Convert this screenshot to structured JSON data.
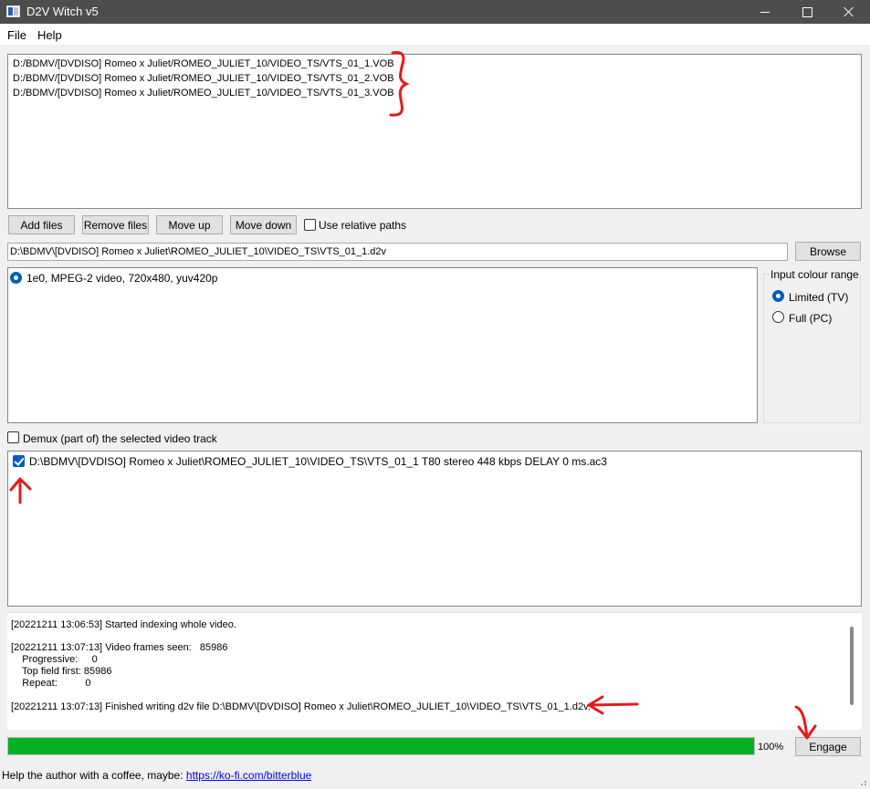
{
  "window": {
    "title": "D2V Witch v5"
  },
  "menu": {
    "file": "File",
    "help": "Help"
  },
  "files": [
    "D:/BDMV/[DVDISO] Romeo x Juliet/ROMEO_JULIET_10/VIDEO_TS/VTS_01_1.VOB",
    "D:/BDMV/[DVDISO] Romeo x Juliet/ROMEO_JULIET_10/VIDEO_TS/VTS_01_2.VOB",
    "D:/BDMV/[DVDISO] Romeo x Juliet/ROMEO_JULIET_10/VIDEO_TS/VTS_01_3.VOB"
  ],
  "file_buttons": {
    "add": "Add files",
    "remove": "Remove files",
    "move_up": "Move up",
    "move_down": "Move down",
    "relative_paths": "Use relative paths"
  },
  "output": {
    "path": "D:\\BDMV\\[DVDISO] Romeo x Juliet\\ROMEO_JULIET_10\\VIDEO_TS\\VTS_01_1.d2v",
    "browse": "Browse"
  },
  "video_tracks": [
    "1e0, MPEG-2 video, 720x480, yuv420p"
  ],
  "colour_range": {
    "title": "Input colour range",
    "limited": "Limited (TV)",
    "full": "Full (PC)",
    "selected": "limited"
  },
  "demux_label": "Demux (part of) the selected video track",
  "audio_tracks": [
    {
      "label": "D:\\BDMV\\[DVDISO] Romeo x Juliet\\ROMEO_JULIET_10\\VIDEO_TS\\VTS_01_1 T80 stereo 448 kbps DELAY 0 ms.ac3",
      "checked": true
    }
  ],
  "log": {
    "l1": "[20221211 13:06:53] Started indexing whole video.",
    "l2": "[20221211 13:07:13] Video frames seen:   85986",
    "l3": "    Progressive:     0",
    "l4": "    Top field first: 85986",
    "l5": "    Repeat:          0",
    "l6": "[20221211 13:07:13] Finished writing d2v file D:\\BDMV\\[DVDISO] Romeo x Juliet\\ROMEO_JULIET_10\\VIDEO_TS\\VTS_01_1.d2v."
  },
  "progress": {
    "value": 1.0,
    "label": "100%",
    "color": "#06b025"
  },
  "engage": "Engage",
  "footer": {
    "text": "Help the author with a coffee, maybe: ",
    "link": "https://ko-fi.com/bitterblue"
  },
  "colors": {
    "titlebar": "#4d4d4d",
    "accent": "#005fb8",
    "annotation": "#e31b1b"
  }
}
